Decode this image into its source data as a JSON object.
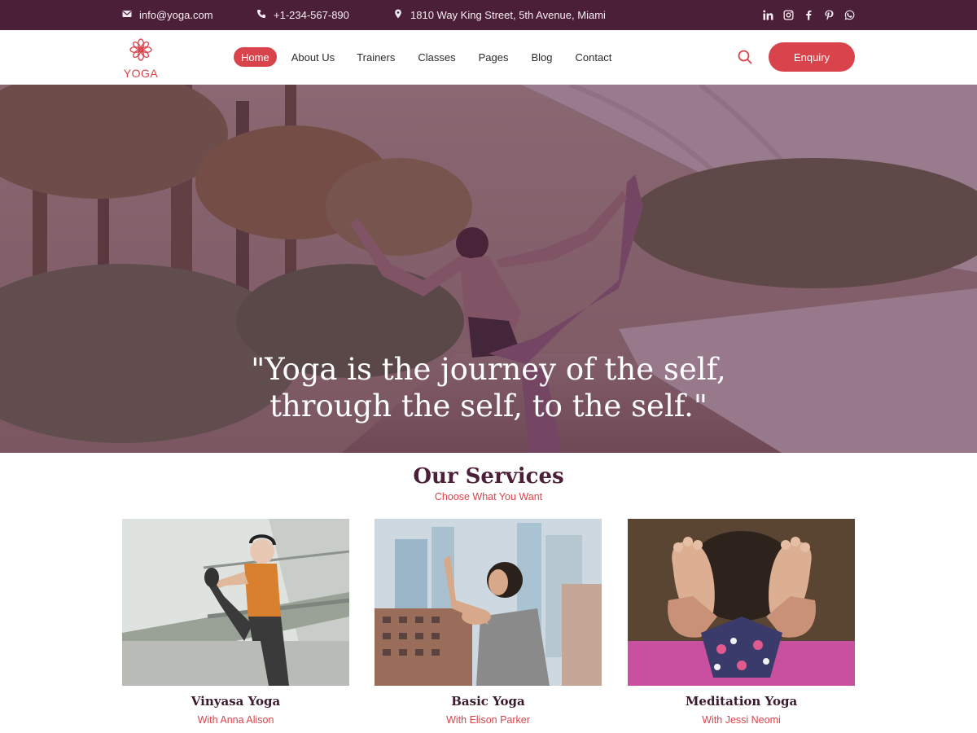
{
  "topbar": {
    "email": "info@yoga.com",
    "phone": "+1-234-567-890",
    "address": "1810 Way King Street, 5th Avenue, Miami",
    "socials": [
      "linkedin-icon",
      "instagram-icon",
      "facebook-icon",
      "pinterest-icon",
      "whatsapp-icon"
    ]
  },
  "header": {
    "logo_text": "YOGA",
    "nav": [
      {
        "label": "Home",
        "active": true
      },
      {
        "label": "About Us"
      },
      {
        "label": "Trainers"
      },
      {
        "label": "Classes"
      },
      {
        "label": "Pages"
      },
      {
        "label": "Blog"
      },
      {
        "label": "Contact"
      }
    ],
    "enquiry_label": "Enquiry"
  },
  "hero": {
    "quote_line1": "\"Yoga is the journey of the self,",
    "quote_line2": "through the self, to the self.\""
  },
  "services": {
    "title": "Our Services",
    "subtitle": "Choose What You Want",
    "cards": [
      {
        "title": "Vinyasa Yoga",
        "trainer": "With Anna Alison"
      },
      {
        "title": "Basic Yoga",
        "trainer": "With Elison Parker"
      },
      {
        "title": "Meditation Yoga",
        "trainer": "With Jessi Neomi"
      }
    ]
  },
  "colors": {
    "brand_dark": "#4b1f38",
    "accent": "#d9434b"
  }
}
